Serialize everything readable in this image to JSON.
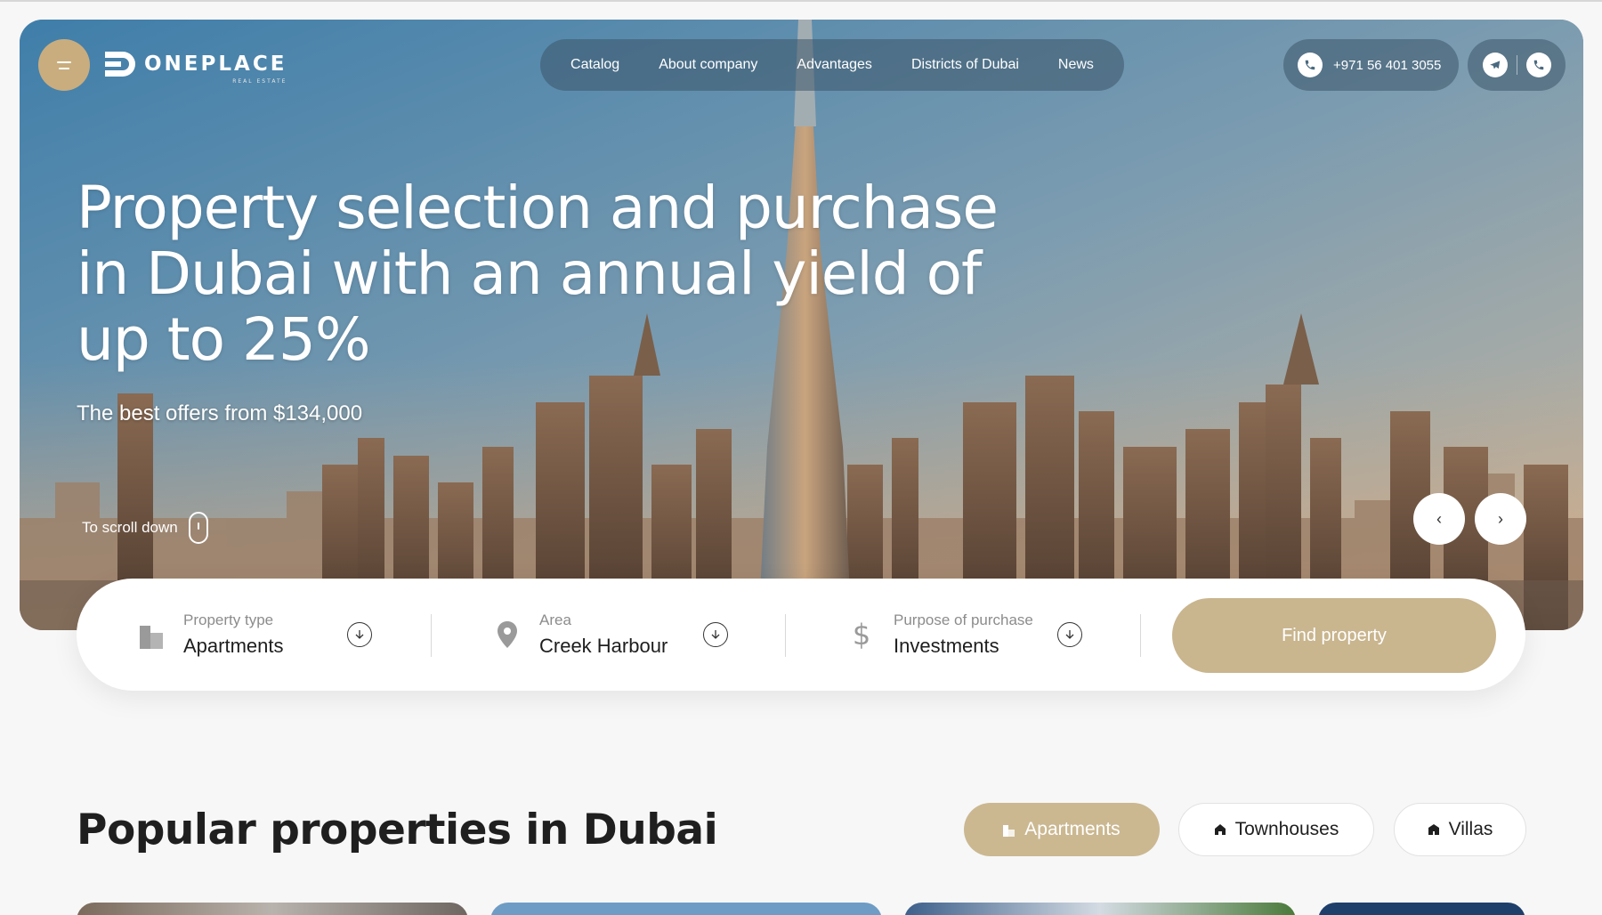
{
  "header": {
    "menu_icon": "menu-icon",
    "brand": "ONEPLACE",
    "brand_sub": "REAL ESTATE",
    "nav": [
      "Catalog",
      "About company",
      "Advantages",
      "Districts of Dubai",
      "News"
    ],
    "phone": "+971 56 401 3055",
    "socials": [
      "telegram-icon",
      "whatsapp-icon"
    ]
  },
  "hero": {
    "title": "Property selection and purchase in Dubai with an annual yield of up to 25%",
    "subtitle": "The best offers from $134,000",
    "scroll_label": "To scroll down",
    "prev": "‹",
    "next": "›"
  },
  "search": {
    "fields": [
      {
        "label": "Property type",
        "value": "Apartments",
        "icon": "building-icon"
      },
      {
        "label": "Area",
        "value": "Creek Harbour",
        "icon": "location-pin-icon"
      },
      {
        "label": "Purpose of purchase",
        "value": "Investments",
        "icon": "dollar-icon"
      }
    ],
    "button": "Find property"
  },
  "popular": {
    "title": "Popular properties in Dubai",
    "filters": [
      {
        "label": "Apartments",
        "active": true,
        "icon": "apartment-icon"
      },
      {
        "label": "Townhouses",
        "active": false,
        "icon": "house-icon"
      },
      {
        "label": "Villas",
        "active": false,
        "icon": "villa-icon"
      }
    ]
  },
  "colors": {
    "accent": "#c9ad7e",
    "button": "#c9b58e",
    "text": "#1f1f1f"
  }
}
